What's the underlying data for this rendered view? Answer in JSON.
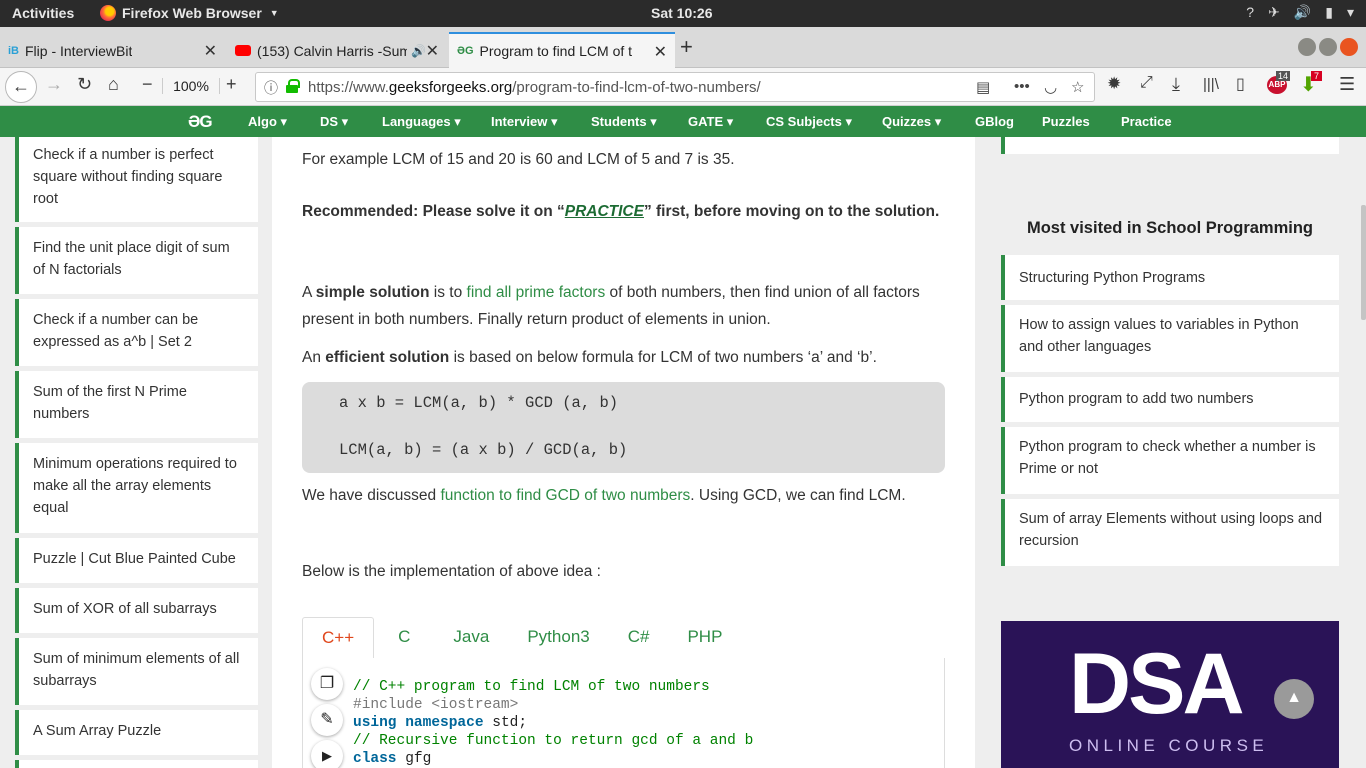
{
  "topbar": {
    "activities": "Activities",
    "app_name": "Firefox Web Browser",
    "clock": "Sat 10:26"
  },
  "tabs": [
    {
      "title": "Flip - InterviewBit",
      "favicon": "interviewbit-icon"
    },
    {
      "title": "(153) Calvin Harris -Sum",
      "favicon": "youtube-icon"
    },
    {
      "title": "Program to find LCM of t",
      "favicon": "gfg-icon"
    }
  ],
  "navbar": {
    "zoom": "100%",
    "url_prefix": "https://www.",
    "url_host": "geeksforgeeks.org",
    "url_path": "/program-to-find-lcm-of-two-numbers/",
    "library_badge": "14",
    "download_badge": "7"
  },
  "site_nav": {
    "logo": "ƏG",
    "items": [
      "Algo ▾",
      "DS ▾",
      "Languages ▾",
      "Interview ▾",
      "Students ▾",
      "GATE ▾",
      "CS Subjects ▾",
      "Quizzes ▾",
      "GBlog",
      "Puzzles",
      "Practice"
    ]
  },
  "left_sidebar": [
    "Check if a number is perfect square without finding square root",
    "Find the unit place digit of sum of N factorials",
    "Check if a number can be expressed as a^b | Set 2",
    "Sum of the first N Prime numbers",
    "Minimum operations required to make all the array elements equal",
    "Puzzle | Cut Blue Painted Cube",
    "Sum of XOR of all subarrays",
    "Sum of minimum elements of all subarrays",
    "A Sum Array Puzzle"
  ],
  "article": {
    "example": "For example LCM of 15 and 20 is 60 and LCM of 5 and 7 is 35.",
    "rec_pre": "Recommended: Please solve it on “",
    "rec_link": "PRACTICE",
    "rec_post": "” first, before moving on to the solution.",
    "simple_a": "A ",
    "simple_b": "simple solution",
    "simple_c": " is to ",
    "simple_link": "find all prime factors",
    "simple_d": " of both numbers, then find union of all factors present in both numbers. Finally return product of elements in union.",
    "eff_a": "An ",
    "eff_b": "efficient solution",
    "eff_c": " is based on below formula for LCM of two numbers ‘a’ and ‘b’.",
    "formula1": "a x b = LCM(a, b) * GCD (a, b)",
    "formula2": "LCM(a, b) = (a x b) / GCD(a, b)",
    "disc_a": "We have discussed ",
    "disc_link": "function to find GCD of two numbers",
    "disc_b": ". Using GCD, we can find LCM.",
    "impl": "Below is the implementation of above idea :",
    "code_tabs": [
      "C++",
      "C",
      "Java",
      "Python3",
      "C#",
      "PHP"
    ],
    "code": {
      "l1": "// C++ program to find LCM of two numbers",
      "l2": "#include <iostream>",
      "l3_kw1": "using",
      "l3_kw2": "namespace",
      "l3_rest": " std;",
      "l4": "// Recursive function to return gcd of a and b",
      "l5_kw": "class",
      "l5_rest": " gfg"
    }
  },
  "right_sidebar": {
    "heading": "Most visited in School Programming",
    "items": [
      "Structuring Python Programs",
      "How to assign values to variables in Python and other languages",
      "Python program to add two numbers",
      "Python program to check whether a number is Prime or not",
      "Sum of array Elements without using loops and recursion"
    ]
  },
  "ad": {
    "title": "DSA",
    "subtitle": "ONLINE COURSE"
  },
  "colors": {
    "brand_green": "#2f8d46",
    "active_tab_red": "#e0471c",
    "ubuntu_orange": "#e95420"
  }
}
